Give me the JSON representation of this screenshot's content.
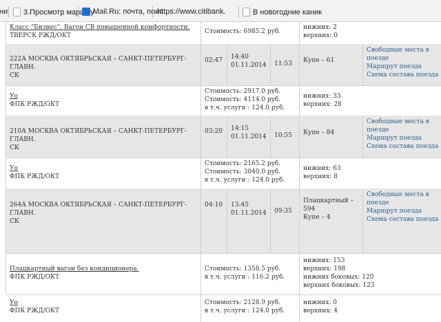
{
  "bookmarks": [
    {
      "label": "ни"
    },
    {
      "label": "3.Просмотр маршру",
      "icon": "page-icon"
    },
    {
      "label": "Mail.Ru: почта, поис",
      "icon": "mailru-icon"
    },
    {
      "label": "https://www.citibank.",
      "icon": "citibank-icon"
    },
    {
      "label": "В новогодние каник",
      "icon": "page-icon"
    }
  ],
  "car_rows": [
    {
      "desc": "Класс \"Бизнес\". Вагон СВ повышенной комфортности.",
      "carrier": "ТВЕРСК РЖД/ОКТ",
      "price_lines": [
        "Стоимость: 6985.2 руб."
      ],
      "seat_lines": [
        "нижних: 2",
        "верхних: 0"
      ]
    },
    {
      "desc": "Уо",
      "carrier": "ФПК РЖД/ОКТ",
      "price_lines": [
        "Стоимость: 2917.0 руб.",
        "Стоимость: 4114.0 руб.",
        "в т.ч. услуги : 124.0 руб."
      ],
      "seat_lines": [
        "нижних: 33",
        "верхних: 28"
      ]
    },
    {
      "desc": "Уо",
      "carrier": "ФПК РЖД/ОКТ",
      "price_lines": [
        "Стоимость: 2165.2 руб.",
        "Стоимость: 3040.0 руб.",
        "в т.ч. услуги : 124.0 руб."
      ],
      "seat_lines": [
        "нижних: 63",
        "верхних: 8"
      ]
    },
    {
      "desc": "Плацкартный вагон без кондиционера.",
      "carrier": "ФПК РЖД/ОКТ",
      "price_lines": [
        "Стоимость: 1358.5 руб.",
        "в т.ч. услуги : 116.2 руб."
      ],
      "seat_lines": [
        "нижних: 153",
        "верхних: 198",
        "нижних боковых: 120",
        "верхних боковых: 123"
      ]
    },
    {
      "desc": "Уо",
      "carrier": "ФПК РЖД/ОКТ",
      "price_lines": [
        "Стоимость: 2128.9 руб.",
        "в т.ч. услуги : 124.0 руб."
      ],
      "seat_lines": [
        "нижних: 0",
        "верхних: 4"
      ]
    }
  ],
  "train_rows": [
    {
      "route_line1": "222А МОСКВА ОКТЯБРЬСКАЯ – САНКТ-ПЕТЕРБУРГ-ГЛАВН.",
      "route_line2": "СК",
      "departure": "02:47",
      "arrival_time": "14:40",
      "arrival_date": "01.11.2014",
      "duration": "11:53",
      "car_type_lines": [
        "Купе – 61"
      ],
      "links": [
        "Свободные места в поезде",
        "Маршрут поезда",
        "Схема состава поезда"
      ]
    },
    {
      "route_line1": "210А МОСКВА ОКТЯБРЬСКАЯ – САНКТ-ПЕТЕРБУРГ-ГЛАВН.",
      "route_line2": "СК",
      "departure": "03:20",
      "arrival_time": "14:15",
      "arrival_date": "01.11.2014",
      "duration": "10:55",
      "car_type_lines": [
        "Купе – 84"
      ],
      "links": [
        "Свободные места в поезде",
        "Маршрут поезда",
        "Схема состава поезда"
      ]
    },
    {
      "route_line1": "264А МОСКВА ОКТЯБРЬСКАЯ – САНКТ-ПЕТЕРБУРГ-ГЛАВН.",
      "route_line2": "СК",
      "departure": "04:10",
      "arrival_time": "13:45",
      "arrival_date": "01.11.2014",
      "duration": "09:35",
      "car_type_lines": [
        "Плацкартный –",
        "594",
        "Купе – 4"
      ],
      "links": [
        "Свободные места в поезде",
        "Маршрут поезда",
        "Схема состава поезда"
      ]
    }
  ]
}
